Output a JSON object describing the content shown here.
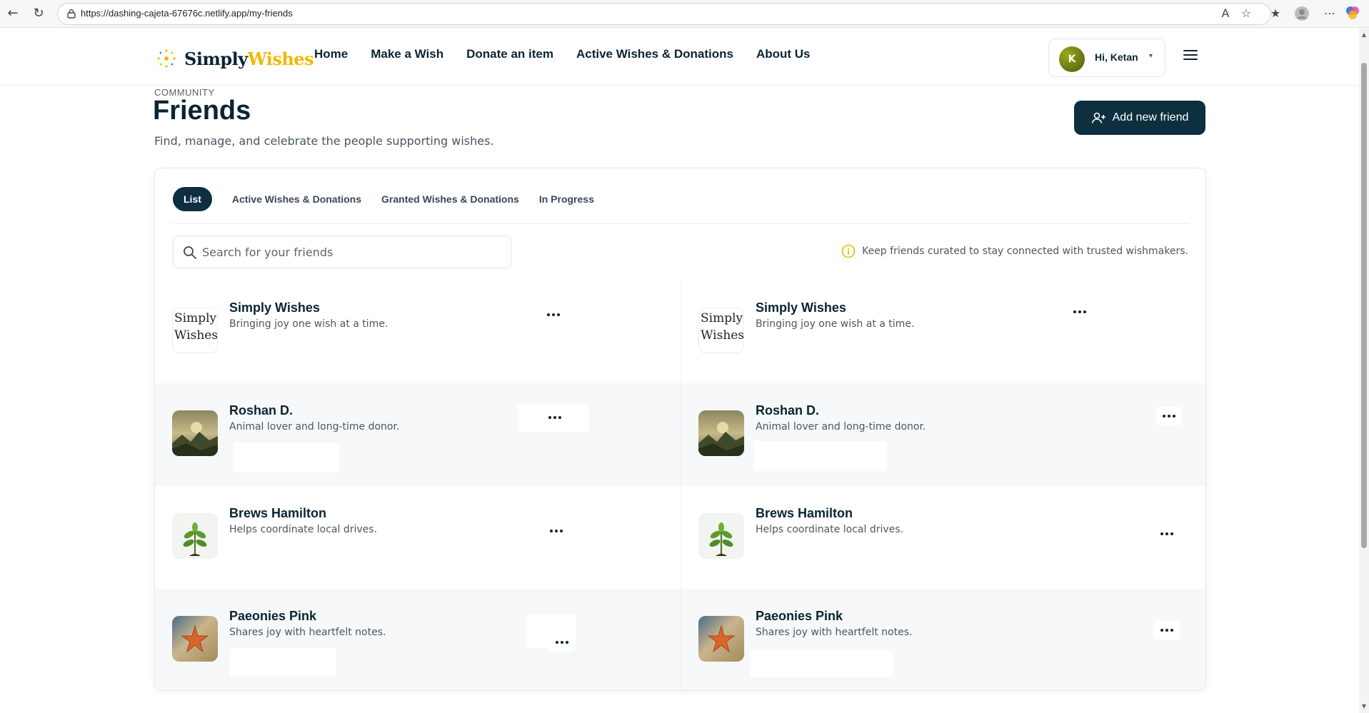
{
  "browser": {
    "url": "https://dashing-cajeta-67676c.netlify.app/my-friends"
  },
  "header": {
    "logo_part1": "Simply",
    "logo_part2": "Wishes",
    "nav": [
      "Home",
      "Make a Wish",
      "Donate an item",
      "Active Wishes & Donations",
      "About Us"
    ],
    "user_initial": "K",
    "user_greeting": "Hi, Ketan"
  },
  "page": {
    "eyebrow": "COMMUNITY",
    "title": "Friends",
    "subtitle": "Find, manage, and celebrate the people supporting wishes.",
    "add_button": "Add new friend"
  },
  "tabs": [
    "List",
    "Active Wishes & Donations",
    "Granted Wishes & Donations",
    "In Progress"
  ],
  "active_tab": "List",
  "search": {
    "placeholder": "Search for your friends"
  },
  "tip": "Keep friends curated to stay connected with trusted wishmakers.",
  "friends": [
    {
      "name": "Simply Wishes",
      "bio": "Bringing joy one wish at a time.",
      "avatar": "broken",
      "alt": "Simply Wishes"
    },
    {
      "name": "Simply Wishes",
      "bio": "Bringing joy one wish at a time.",
      "avatar": "broken",
      "alt": "Simply Wishes"
    },
    {
      "name": "Roshan D.",
      "bio": "Animal lover and long-time donor.",
      "avatar": "landscape"
    },
    {
      "name": "Roshan D.",
      "bio": "Animal lover and long-time donor.",
      "avatar": "landscape"
    },
    {
      "name": "Brews Hamilton",
      "bio": "Helps coordinate local drives.",
      "avatar": "plant"
    },
    {
      "name": "Brews Hamilton",
      "bio": "Helps coordinate local drives.",
      "avatar": "plant"
    },
    {
      "name": "Paeonies Pink",
      "bio": "Shares joy with heartfelt notes.",
      "avatar": "starfish"
    },
    {
      "name": "Paeonies Pink",
      "bio": "Shares joy with heartfelt notes.",
      "avatar": "starfish"
    }
  ],
  "colors": {
    "primary": "#0d2f3f",
    "accent": "#f2b705",
    "text": "#0b2433"
  }
}
